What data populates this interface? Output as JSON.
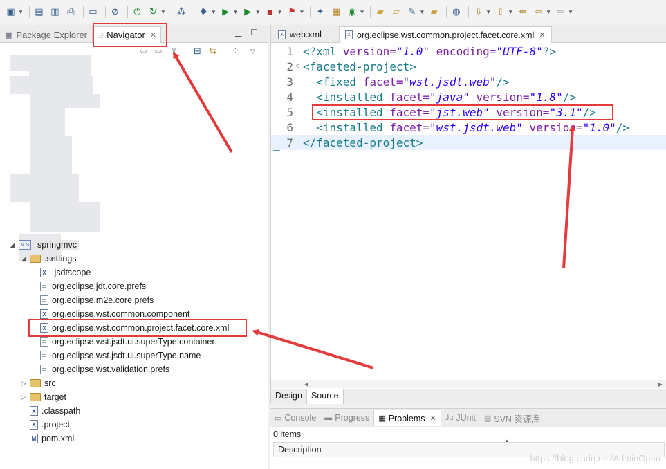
{
  "toolbar": {
    "buttons": [
      "new-icon",
      "save-icon",
      "save-all-icon",
      "print-icon",
      "task-icon",
      "console-icon",
      "skip-breakpoints-icon",
      "power-icon",
      "refresh-icon",
      "debug-icon",
      "run-icon",
      "run-ext-icon",
      "stop-icon",
      "external-tools-icon",
      "new-java-class-icon",
      "new-package-icon",
      "open-type-icon",
      "open-folder-icon",
      "open-resource-icon",
      "wand-icon",
      "folder-icon",
      "web-browser-icon",
      "next-annotation-icon",
      "prev-annotation-icon",
      "back-icon",
      "forward-icon"
    ]
  },
  "left_panel": {
    "tabs": [
      {
        "label": "Package Explorer"
      },
      {
        "label": "Navigator"
      }
    ],
    "tree": {
      "project": "springmvc",
      "settings_folder": ".settings",
      "settings_files": [
        ".jsdtscope",
        "org.eclipse.jdt.core.prefs",
        "org.eclipse.m2e.core.prefs",
        "org.eclipse.wst.common.component",
        "org.eclipse.wst.common.project.facet.core.xml",
        "org.eclipse.wst.jsdt.ui.superType.container",
        "org.eclipse.wst.jsdt.ui.superType.name",
        "org.eclipse.wst.validation.prefs"
      ],
      "folders": [
        "src",
        "target"
      ],
      "root_files": [
        ".classpath",
        ".project",
        "pom.xml"
      ]
    }
  },
  "editor": {
    "tabs": [
      {
        "label": "web.xml"
      },
      {
        "label": "org.eclipse.wst.common.project.facet.core.xml"
      }
    ],
    "lines": [
      {
        "num": "1"
      },
      {
        "num": "2"
      },
      {
        "num": "3"
      },
      {
        "num": "4"
      },
      {
        "num": "5"
      },
      {
        "num": "6"
      },
      {
        "num": "7"
      }
    ],
    "code": {
      "l1_pi_open": "<?xml ",
      "l1_attr1": "version=",
      "l1_val1": "\"1.0\"",
      "l1_attr2": " encoding=",
      "l1_val2": "\"UTF-8\"",
      "l1_pi_close": "?>",
      "l2": "<faceted-project>",
      "l3_tag": "  <fixed ",
      "l3_attr": "facet=",
      "l3_val": "\"wst.jsdt.web\"",
      "l3_close": "/>",
      "l4_tag": "  <installed ",
      "l4_attr1": "facet=",
      "l4_val1": "\"java\"",
      "l4_attr2": " version=",
      "l4_val2": "\"1.8\"",
      "l4_close": "/>",
      "l5_tag": "  <installed ",
      "l5_attr1": "facet=",
      "l5_val1": "\"jst.web\"",
      "l5_attr2": " version=",
      "l5_val2": "\"3.1\"",
      "l5_close": "/>",
      "l6_tag": "  <installed ",
      "l6_attr1": "facet=",
      "l6_val1": "\"wst.jsdt.web\"",
      "l6_attr2": " version=",
      "l6_val2": "\"1.0\"",
      "l6_close": "/>",
      "l7": "</faceted-project>"
    },
    "bottom_tabs": [
      {
        "label": "Design"
      },
      {
        "label": "Source"
      }
    ]
  },
  "bottom_panel": {
    "tabs": [
      {
        "label": "Console"
      },
      {
        "label": "Progress"
      },
      {
        "label": "Problems"
      },
      {
        "label": "JUnit"
      },
      {
        "label": "SVN 资源库"
      }
    ],
    "items_count": "0 items",
    "column_header": "Description",
    "watermark": "https://blog.csdn.net/AdminGuan"
  },
  "colors": {
    "annotation": "#e33b3b",
    "xml_tag": "#167a8a",
    "xml_attr": "#7a1fa2",
    "xml_value": "#2a00ff"
  }
}
